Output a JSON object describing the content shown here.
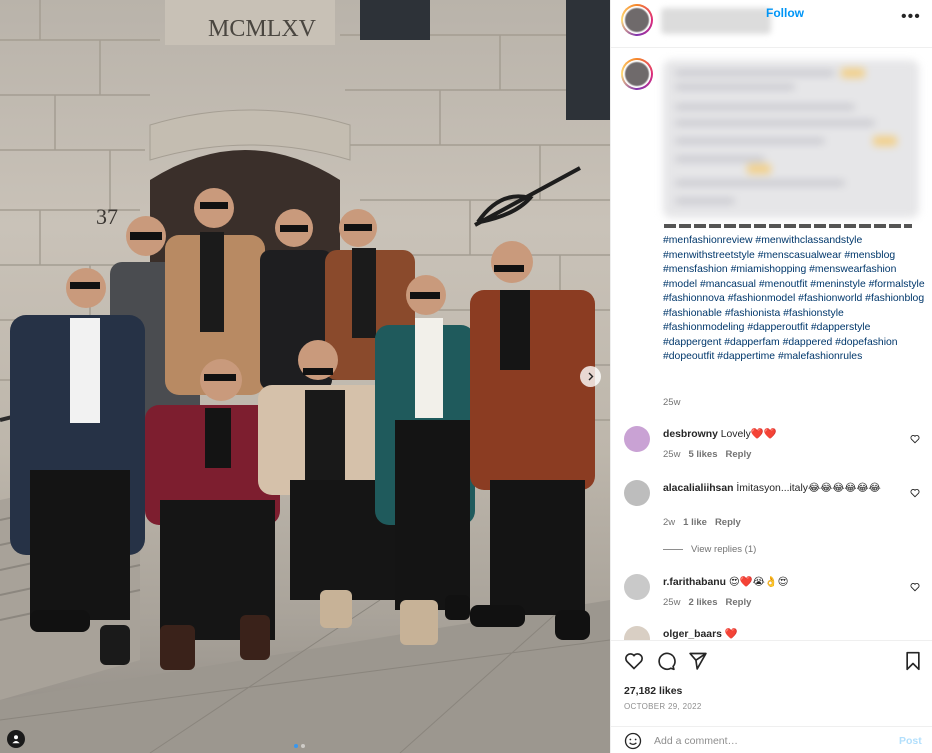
{
  "post": {
    "media": {
      "building_inscription": "MCMLXV",
      "building_number": "37",
      "carousel_count": 2,
      "carousel_active_index": 0
    },
    "header": {
      "follow_label": "Follow",
      "more_icon": "more-horizontal-icon"
    },
    "caption": {
      "hashtags": "#menfashionreview #menwithclassandstyle #menwithstreetstyle #menscasualwear #mensblog #mensfashion #miamishopping #menswearfashion #model #mancasual #menoutfit #meninstyle #formalstyle #fashionnova #fashionmodel #fashionworld #fashionblog #fashionable #fashionista #fashionstyle #fashionmodeling #dapperoutfit #dapperstyle #dappergent #dapperfam #dappered #dopefashion #dopeoutfit #dappertime #malefashionrules",
      "age": "25w"
    },
    "comments": [
      {
        "user": "desbrowny",
        "text": "Lovely❤️❤️",
        "age": "25w",
        "likes": "5 likes",
        "reply": "Reply",
        "avatar_color": "#c9a2d4"
      },
      {
        "user": "alacalialiihsan",
        "text": "İmitasyon...italy😂😂😂😂😂😂",
        "age": "2w",
        "likes": "1 like",
        "reply": "Reply",
        "view_replies": "View replies (1)",
        "avatar_color": "#bdbdbd"
      },
      {
        "user": "r.farithabanu",
        "text": "😍❤️😭👌😍",
        "age": "25w",
        "likes": "2 likes",
        "reply": "Reply",
        "avatar_color": "#c9c9c9"
      },
      {
        "user": "olger_baars",
        "text": "❤️",
        "avatar_color": "#d9cfc4"
      }
    ],
    "likes": "27,182 likes",
    "date": "OCTOBER 29, 2022",
    "add_comment": {
      "placeholder": "Add a comment…",
      "post_label": "Post"
    },
    "colors": {
      "accent": "#0095f6",
      "hashtag": "#00376b",
      "muted": "#737373"
    }
  }
}
